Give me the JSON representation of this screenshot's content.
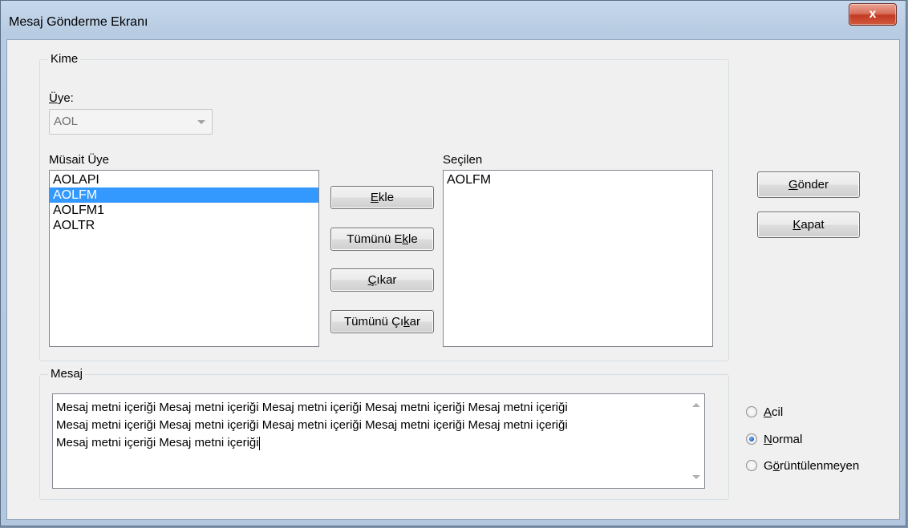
{
  "window": {
    "title": "Mesaj Gönderme Ekranı",
    "close_label": "x"
  },
  "kime": {
    "legend": "Kime",
    "uye_label_prefix": "Ü",
    "uye_label_rest": "ye:",
    "uye_value": "AOL",
    "musait_label": "Müsait Üye",
    "secilen_label": "Seçilen",
    "musait_items": [
      "AOLAPI",
      "AOLFM",
      "AOLFM1",
      "AOLTR"
    ],
    "musait_selected_index": 1,
    "secilen_items": [
      "AOLFM"
    ]
  },
  "buttons": {
    "ekle": {
      "ul": "E",
      "rest": "kle"
    },
    "tumunu_ekle": {
      "pre": "Tümünü E",
      "ul": "k",
      "rest": "le"
    },
    "cikar": {
      "ul": "Ç",
      "rest": "ıkar"
    },
    "tumunu_cikar": {
      "pre": "Tümünü Çı",
      "ul": "k",
      "rest": "ar"
    },
    "gonder": {
      "ul": "G",
      "rest": "önder"
    },
    "kapat": {
      "ul": "K",
      "rest": "apat"
    }
  },
  "mesaj": {
    "legend": "Mesaj",
    "lines": [
      "Mesaj metni içeriği Mesaj metni içeriği Mesaj metni içeriği Mesaj metni içeriği Mesaj metni içeriği",
      "Mesaj metni içeriği Mesaj metni içeriği Mesaj metni içeriği Mesaj metni içeriği Mesaj metni içeriği",
      "Mesaj metni içeriği Mesaj metni içeriği"
    ]
  },
  "priority": {
    "options": [
      {
        "ul": "A",
        "rest": "cil",
        "checked": false
      },
      {
        "ul": "N",
        "rest": "ormal",
        "checked": true
      },
      {
        "pre": "G",
        "ul": "ö",
        "rest": "rüntülenmeyen",
        "checked": false
      }
    ]
  }
}
